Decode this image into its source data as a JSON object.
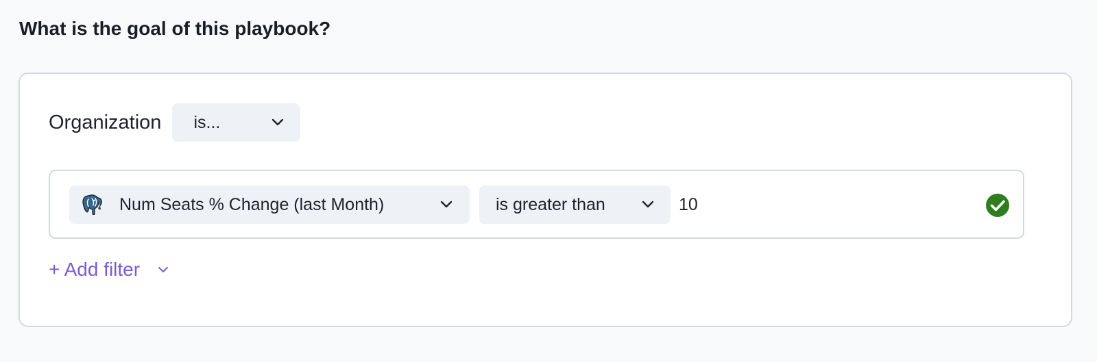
{
  "header": {
    "question": "What is the goal of this playbook?"
  },
  "goal": {
    "entity_label": "Organization",
    "entity_condition": "is...",
    "filters": [
      {
        "source_icon": "postgresql-elephant-icon",
        "field": "Num Seats % Change (last Month)",
        "operator": "is greater than",
        "value": "10",
        "status": "valid"
      }
    ],
    "add_filter_label": "+ Add filter"
  },
  "colors": {
    "accent": "#7b5ccf",
    "success": "#2e7d1f",
    "border": "#d3d8e1",
    "select_bg": "#eef1f5"
  }
}
